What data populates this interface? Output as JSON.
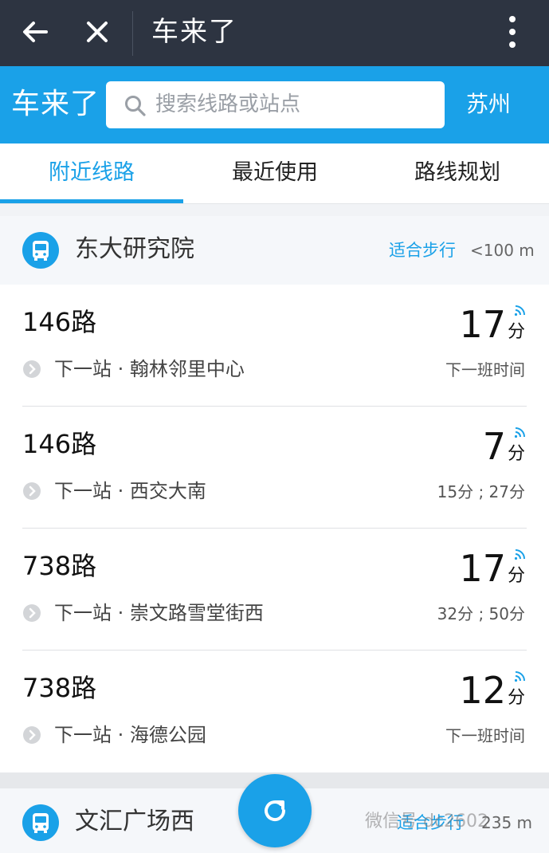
{
  "topbar": {
    "title": "车来了"
  },
  "search": {
    "brand": "车来了",
    "placeholder": "搜索线路或站点",
    "city": "苏州"
  },
  "tabs": [
    {
      "label": "附近线路",
      "active": true
    },
    {
      "label": "最近使用",
      "active": false
    },
    {
      "label": "路线规划",
      "active": false
    }
  ],
  "stations": [
    {
      "name": "东大研究院",
      "walk_label": "适合步行",
      "distance": "<100 m"
    },
    {
      "name": "文汇广场西",
      "walk_label": "适合步行",
      "distance": "235 m"
    }
  ],
  "routes": [
    {
      "route": "146路",
      "next_stop": "下一站 · 翰林邻里中心",
      "eta": "17",
      "eta_unit": "分",
      "sub": "下一班时间"
    },
    {
      "route": "146路",
      "next_stop": "下一站 · 西交大南",
      "eta": "7",
      "eta_unit": "分",
      "sub": "15分 ; 27分"
    },
    {
      "route": "738路",
      "next_stop": "下一站 · 崇文路雪堂街西",
      "eta": "17",
      "eta_unit": "分",
      "sub": "32分 ; 50分"
    },
    {
      "route": "738路",
      "next_stop": "下一站 · 海德公园",
      "eta": "12",
      "eta_unit": "分",
      "sub": "下一班时间"
    }
  ],
  "watermark": "微信号 dc2602",
  "colors": {
    "accent": "#1aa1e8",
    "topbar": "#2d3441"
  },
  "icons": {
    "back": "back-arrow-icon",
    "close": "close-icon",
    "menu": "more-vert-icon",
    "search": "search-icon",
    "bus": "bus-icon",
    "signal": "signal-icon",
    "refresh": "refresh-icon",
    "chevron": "chevron-right-icon"
  }
}
